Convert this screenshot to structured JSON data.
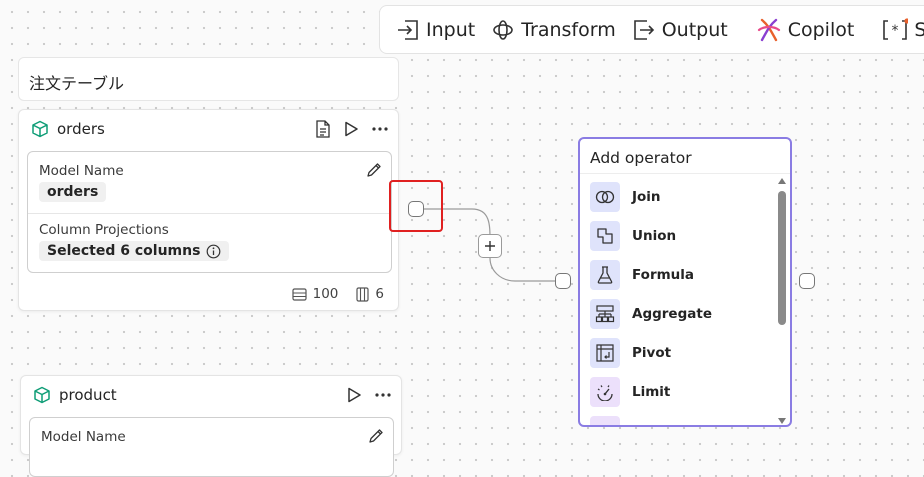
{
  "toolbar": {
    "items": [
      {
        "label": "Input",
        "icon": "input-icon"
      },
      {
        "label": "Transform",
        "icon": "transform-icon"
      },
      {
        "label": "Output",
        "icon": "output-icon"
      },
      {
        "label": "Copilot",
        "icon": "copilot-icon"
      },
      {
        "label": "SQ",
        "icon": "sql-icon"
      }
    ]
  },
  "canvas": {
    "note_title": "注文テーブル"
  },
  "orders_node": {
    "title": "orders",
    "model_name_label": "Model Name",
    "model_name_value": "orders",
    "column_projections_label": "Column Projections",
    "column_projections_value": "Selected 6 columns",
    "rows": "100",
    "columns": "6"
  },
  "product_node": {
    "title": "product",
    "model_name_label": "Model Name"
  },
  "add_operator": {
    "title": "Add operator",
    "operators": [
      {
        "label": "Join",
        "icon": "join-icon",
        "color": "#dfe3fb"
      },
      {
        "label": "Union",
        "icon": "union-icon",
        "color": "#dfe3fb"
      },
      {
        "label": "Formula",
        "icon": "formula-icon",
        "color": "#dfe3fb"
      },
      {
        "label": "Aggregate",
        "icon": "aggregate-icon",
        "color": "#dfe3fb"
      },
      {
        "label": "Pivot",
        "icon": "pivot-icon",
        "color": "#dfe3fb"
      },
      {
        "label": "Limit",
        "icon": "limit-icon",
        "color": "#ece0fb"
      }
    ]
  },
  "colors": {
    "accent": "#8a7ce3",
    "highlight": "#e02020",
    "model_icon": "#0f9d77"
  }
}
